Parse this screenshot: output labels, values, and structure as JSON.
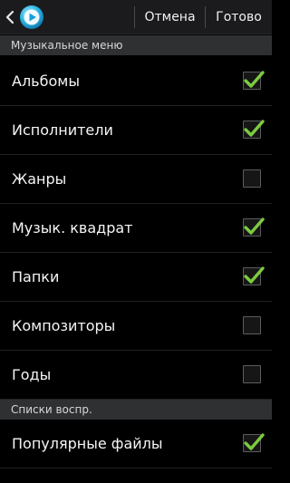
{
  "action_bar": {
    "cancel_label": "Отмена",
    "done_label": "Готово",
    "up_icon": "chevron-left-icon",
    "app_icon": "music-player-icon"
  },
  "sections": [
    {
      "header": "Музыкальное меню",
      "items": [
        {
          "label": "Альбомы",
          "checked": true
        },
        {
          "label": "Исполнители",
          "checked": true
        },
        {
          "label": "Жанры",
          "checked": false
        },
        {
          "label": "Музык. квадрат",
          "checked": true
        },
        {
          "label": "Папки",
          "checked": true
        },
        {
          "label": "Композиторы",
          "checked": false
        },
        {
          "label": "Годы",
          "checked": false
        }
      ]
    },
    {
      "header": "Списки воспр.",
      "items": [
        {
          "label": "Популярные файлы",
          "checked": true
        }
      ]
    }
  ],
  "colors": {
    "check": "#7ccb3f",
    "background": "#000000",
    "section_header_bg": "#2f3032",
    "action_bar_bg": "#1b1b1d"
  }
}
